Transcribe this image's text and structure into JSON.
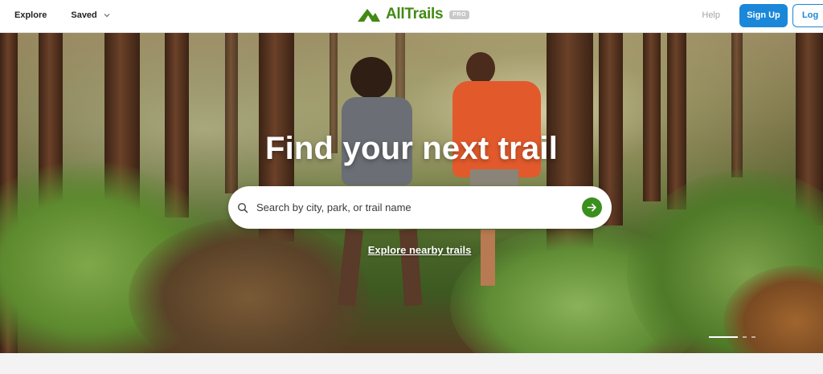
{
  "nav": {
    "explore_label": "Explore",
    "saved_label": "Saved",
    "help_label": "Help",
    "signup_label": "Sign Up",
    "login_label": "Log"
  },
  "brand": {
    "name": "AllTrails",
    "badge": "PRO",
    "color": "#428a13"
  },
  "hero": {
    "title": "Find your next trail",
    "search_placeholder": "Search by city, park, or trail name",
    "explore_nearby_label": "Explore nearby trails",
    "carousel_slide_count": 3,
    "carousel_active_index": 0
  },
  "colors": {
    "primary_blue": "#1a87d8",
    "go_button_green": "#3b8f1e"
  },
  "icons": {
    "search": "search-icon",
    "go": "arrow-right-icon",
    "saved_dropdown": "chevron-down-icon",
    "logo": "mountain-logo-icon"
  }
}
